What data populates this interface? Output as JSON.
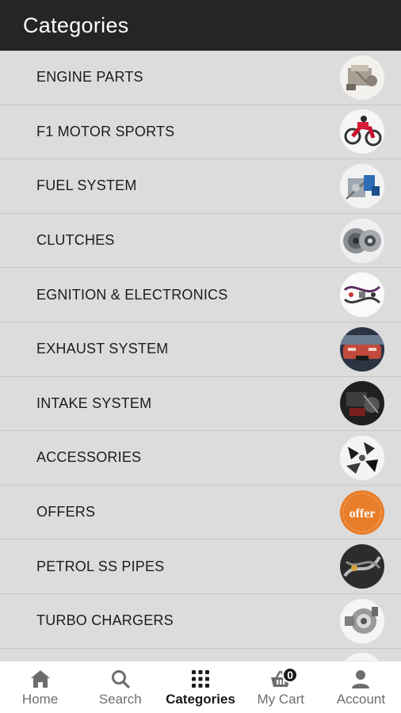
{
  "header": {
    "title": "Categories"
  },
  "categories": [
    {
      "label": "ENGINE PARTS",
      "icon": "engine-parts-thumbnail"
    },
    {
      "label": "F1 MOTOR SPORTS",
      "icon": "motorbike-thumbnail"
    },
    {
      "label": "FUEL SYSTEM",
      "icon": "fuel-pump-thumbnail"
    },
    {
      "label": "CLUTCHES",
      "icon": "clutch-plate-thumbnail"
    },
    {
      "label": "EGNITION & ELECTRONICS",
      "icon": "wiring-harness-thumbnail"
    },
    {
      "label": "EXHAUST SYSTEM",
      "icon": "exhaust-car-rear-thumbnail"
    },
    {
      "label": "INTAKE SYSTEM",
      "icon": "intake-engine-bay-thumbnail"
    },
    {
      "label": "ACCESSORIES",
      "icon": "accessories-thumbnail"
    },
    {
      "label": "OFFERS",
      "icon": "offer-badge-thumbnail",
      "badge_text": "offer"
    },
    {
      "label": "PETROL SS PIPES",
      "icon": "ss-pipes-thumbnail"
    },
    {
      "label": "TURBO CHARGERS",
      "icon": "turbo-charger-thumbnail"
    }
  ],
  "bottom_nav": {
    "items": [
      {
        "label": "Home",
        "icon": "home-icon",
        "active": false
      },
      {
        "label": "Search",
        "icon": "search-icon",
        "active": false
      },
      {
        "label": "Categories",
        "icon": "grid-icon",
        "active": true
      },
      {
        "label": "My Cart",
        "icon": "basket-icon",
        "active": false,
        "badge": "0"
      },
      {
        "label": "Account",
        "icon": "person-icon",
        "active": false
      }
    ]
  },
  "colors": {
    "app_bar": "#252525",
    "list_background": "#dcdcdc",
    "offer_orange": "#e87e2a",
    "nav_active": "#1a1a1a",
    "nav_inactive": "#6d6d6d"
  }
}
